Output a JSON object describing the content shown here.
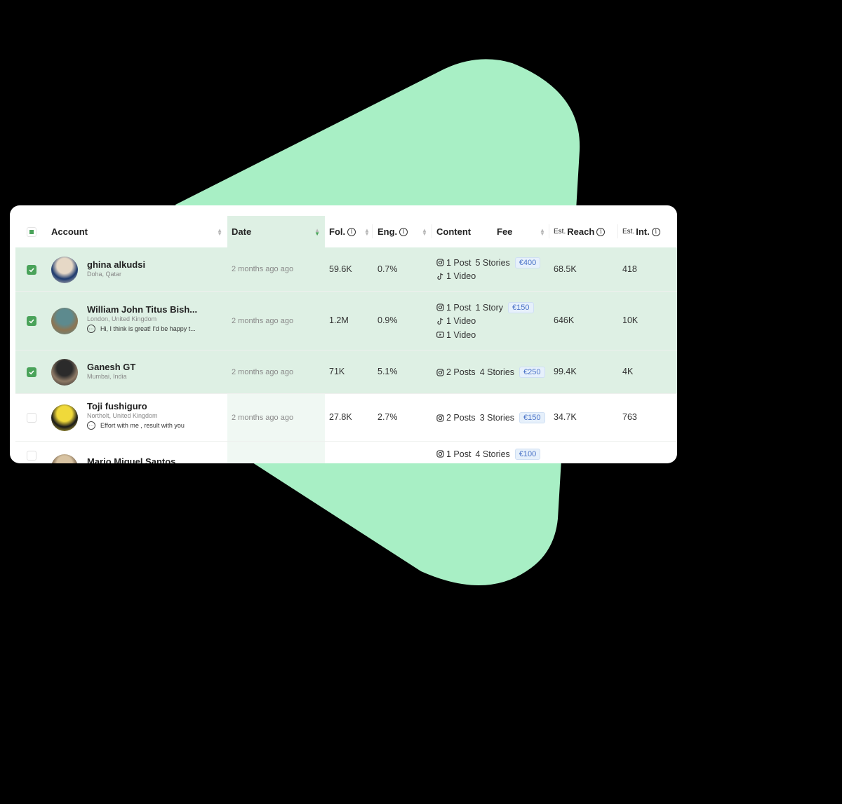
{
  "colors": {
    "background": "#000000",
    "shape": "#a8efc5",
    "selected_row": "#def0e4",
    "accent_green": "#4aa35a",
    "fee_text": "#4a72c7",
    "fee_bg": "#e6f0fb"
  },
  "table": {
    "headers": {
      "account": "Account",
      "date": "Date",
      "followers": "Fol.",
      "engagement": "Eng.",
      "content": "Content",
      "fee": "Fee",
      "reach_prefix": "Est.",
      "reach": "Reach",
      "int_prefix": "Est.",
      "int": "Int."
    },
    "sorted_column": "date",
    "rows": [
      {
        "selected": true,
        "name": "ghina alkudsi",
        "location": "Doha, Qatar",
        "message": "",
        "date": "2 months ago ago",
        "followers": "59.6K",
        "engagement": "0.7%",
        "content": [
          {
            "platform": "instagram-icon",
            "items": [
              "1 Post",
              "5 Stories"
            ],
            "fee": "€400"
          },
          {
            "platform": "tiktok-icon",
            "items": [
              "1 Video"
            ],
            "fee": ""
          }
        ],
        "reach": "68.5K",
        "interactions": "418"
      },
      {
        "selected": true,
        "name": "William John Titus Bish...",
        "location": "London, United Kingdom",
        "message": "Hi, I think is great! I'd be happy t...",
        "date": "2 months ago ago",
        "followers": "1.2M",
        "engagement": "0.9%",
        "content": [
          {
            "platform": "instagram-icon",
            "items": [
              "1 Post",
              "1 Story"
            ],
            "fee": "€150"
          },
          {
            "platform": "tiktok-icon",
            "items": [
              "1 Video"
            ],
            "fee": ""
          },
          {
            "platform": "youtube-icon",
            "items": [
              "1 Video"
            ],
            "fee": ""
          }
        ],
        "reach": "646K",
        "interactions": "10K"
      },
      {
        "selected": true,
        "name": "Ganesh GT",
        "location": "Mumbai, India",
        "message": "",
        "date": "2 months ago ago",
        "followers": "71K",
        "engagement": "5.1%",
        "content": [
          {
            "platform": "instagram-icon",
            "items": [
              "2 Posts",
              "4 Stories"
            ],
            "fee": "€250"
          }
        ],
        "reach": "99.4K",
        "interactions": "4K"
      },
      {
        "selected": false,
        "name": "Toji fushiguro",
        "location": "Northolt, United Kingdom",
        "message": "Effort with me , result with you",
        "date": "2 months ago ago",
        "followers": "27.8K",
        "engagement": "2.7%",
        "content": [
          {
            "platform": "instagram-icon",
            "items": [
              "2 Posts",
              "3 Stories"
            ],
            "fee": "€150"
          }
        ],
        "reach": "34.7K",
        "interactions": "763"
      },
      {
        "selected": false,
        "name": "Mario Miguel Santos",
        "location": "",
        "message": "",
        "date": "",
        "followers": "",
        "engagement": "",
        "content": [
          {
            "platform": "instagram-icon",
            "items": [
              "1 Post",
              "4 Stories"
            ],
            "fee": "€100"
          }
        ],
        "reach": "",
        "interactions": ""
      }
    ]
  }
}
